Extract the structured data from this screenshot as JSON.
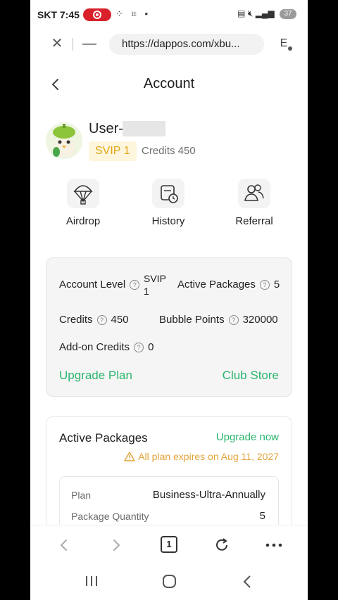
{
  "status_bar": {
    "carrier": "SKT",
    "time": "7:45",
    "battery": "37"
  },
  "browser": {
    "url": "https://dappos.com/xbu...",
    "extension_label": "E"
  },
  "page": {
    "title": "Account",
    "user": {
      "name": "User-",
      "level": "SVIP 1",
      "credits": "Credits 450"
    },
    "quick_actions": [
      {
        "label": "Airdrop",
        "icon": "parachute-icon"
      },
      {
        "label": "History",
        "icon": "calendar-clock-icon"
      },
      {
        "label": "Referral",
        "icon": "users-icon"
      }
    ],
    "account_info": {
      "account_level_label": "Account Level",
      "account_level_value_line1": "SVIP",
      "account_level_value_line2": "1",
      "active_packages_label": "Active Packages",
      "active_packages_value": "5",
      "credits_label": "Credits",
      "credits_value": "450",
      "bubble_points_label": "Bubble Points",
      "bubble_points_value": "320000",
      "addon_credits_label": "Add-on Credits",
      "addon_credits_value": "0",
      "upgrade_plan": "Upgrade Plan",
      "club_store": "Club Store"
    },
    "active_packages": {
      "title": "Active Packages",
      "upgrade_now": "Upgrade now",
      "expiry": "All plan expires on Aug 11, 2027",
      "rows": [
        {
          "label": "Plan",
          "value": "Business-Ultra-Annually"
        },
        {
          "label": "Package Quantity",
          "value": "5"
        }
      ]
    }
  },
  "toolbar": {
    "tab_count": "1"
  },
  "colors": {
    "accent_green": "#2bb56e",
    "svip_gold": "#e3a61b",
    "warning_orange": "#e2a43a",
    "recording_red": "#d9212b"
  }
}
